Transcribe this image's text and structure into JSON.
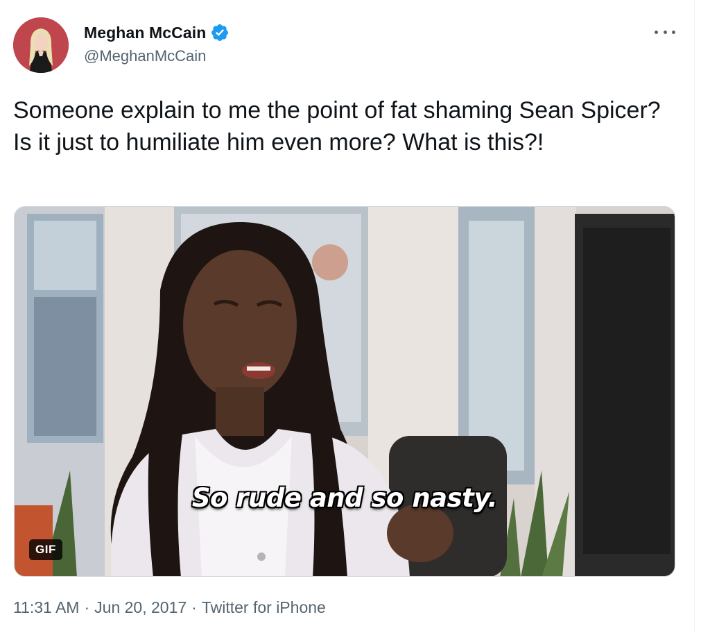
{
  "author": {
    "display_name": "Meghan McCain",
    "handle": "@MeghanMcCain",
    "verified": true
  },
  "tweet": {
    "text": "Someone explain to me the point of fat shaming Sean Spicer? Is it just to humiliate him even more? What is this?!"
  },
  "media": {
    "caption": "So rude and so nasty.",
    "badge": "GIF"
  },
  "footer": {
    "time": "11:31 AM",
    "separator": "·",
    "date": "Jun 20, 2017",
    "source": "Twitter for iPhone"
  },
  "colors": {
    "verified": "#1d9bf0",
    "secondary_text": "#536471",
    "primary_text": "#0f1419"
  },
  "icons": {
    "verified": "verified-badge-icon",
    "more": "more-options-icon"
  }
}
